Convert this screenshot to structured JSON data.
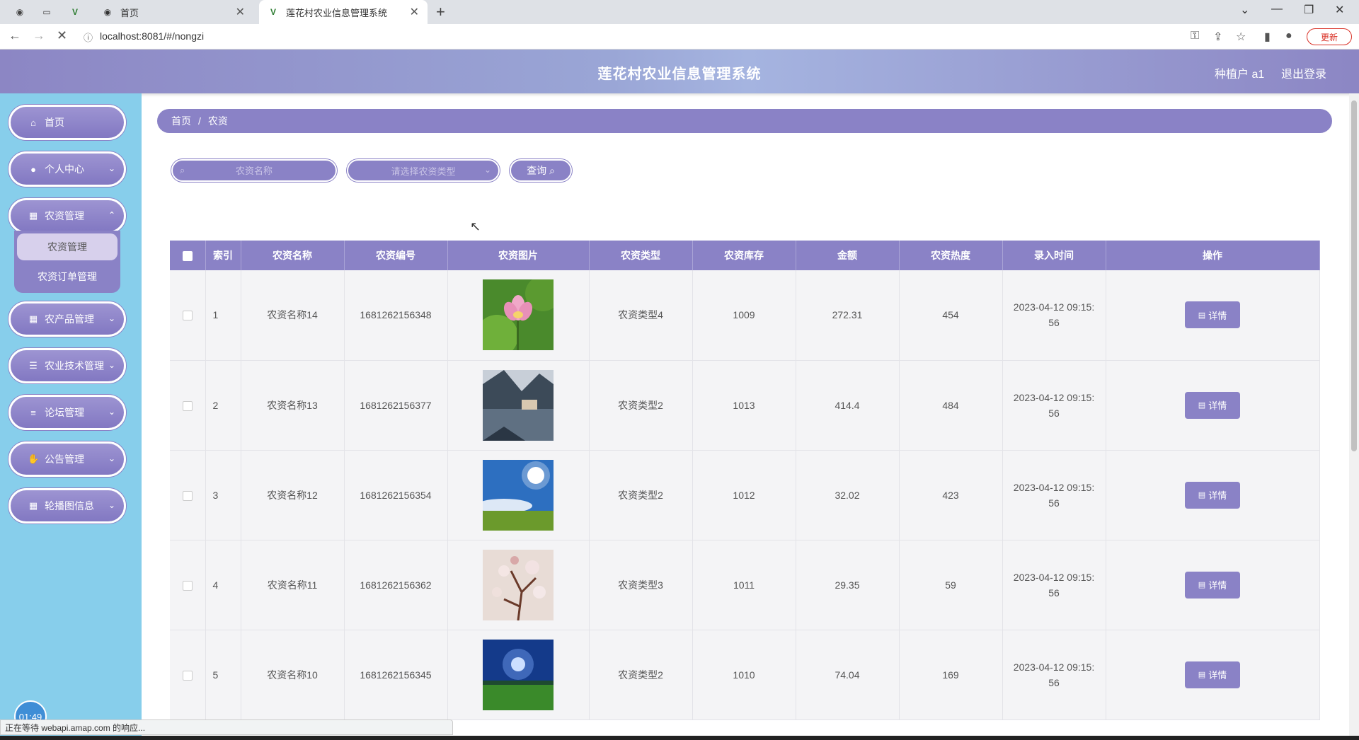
{
  "browser": {
    "tabs": [
      {
        "title": "首页"
      },
      {
        "title": "莲花村农业信息管理系统"
      }
    ],
    "url": "localhost:8081/#/nongzi",
    "update_label": "更新"
  },
  "header": {
    "title": "莲花村农业信息管理系统",
    "user": "种植户 a1",
    "logout": "退出登录"
  },
  "sidebar": {
    "items": [
      {
        "label": "首页",
        "icon": "home-icon"
      },
      {
        "label": "个人中心",
        "icon": "user-icon"
      },
      {
        "label": "农资管理",
        "icon": "grid-icon"
      },
      {
        "label": "农产品管理",
        "icon": "grid-icon"
      },
      {
        "label": "农业技术管理",
        "icon": "sliders-icon"
      },
      {
        "label": "论坛管理",
        "icon": "list-icon"
      },
      {
        "label": "公告管理",
        "icon": "thumb-icon"
      },
      {
        "label": "轮播图信息",
        "icon": "grid-icon"
      }
    ],
    "submenu": [
      {
        "label": "农资管理"
      },
      {
        "label": "农资订单管理"
      }
    ],
    "timer": "01:49"
  },
  "breadcrumb": {
    "home": "首页",
    "current": "农资"
  },
  "filters": {
    "name_placeholder": "农资名称",
    "type_placeholder": "请选择农资类型",
    "query_label": "查询"
  },
  "table": {
    "columns": [
      "索引",
      "农资名称",
      "农资编号",
      "农资图片",
      "农资类型",
      "农资库存",
      "金额",
      "农资热度",
      "录入时间",
      "操作"
    ],
    "rows": [
      {
        "index": "1",
        "name": "农资名称14",
        "code": "1681262156348",
        "type": "农资类型4",
        "stock": "1009",
        "amount": "272.31",
        "heat": "454",
        "time1": "2023-04-12 09:15:",
        "time2": "56",
        "action": "详情",
        "image": "lotus"
      },
      {
        "index": "2",
        "name": "农资名称13",
        "code": "1681262156377",
        "type": "农资类型2",
        "stock": "1013",
        "amount": "414.4",
        "heat": "484",
        "time1": "2023-04-12 09:15:",
        "time2": "56",
        "action": "详情",
        "image": "lake-village"
      },
      {
        "index": "3",
        "name": "农资名称12",
        "code": "1681262156354",
        "type": "农资类型2",
        "stock": "1012",
        "amount": "32.02",
        "heat": "423",
        "time1": "2023-04-12 09:15:",
        "time2": "56",
        "action": "详情",
        "image": "sunny-field"
      },
      {
        "index": "4",
        "name": "农资名称11",
        "code": "1681262156362",
        "type": "农资类型3",
        "stock": "1011",
        "amount": "29.35",
        "heat": "59",
        "time1": "2023-04-12 09:15:",
        "time2": "56",
        "action": "详情",
        "image": "blossom"
      },
      {
        "index": "5",
        "name": "农资名称10",
        "code": "1681262156345",
        "type": "农资类型2",
        "stock": "1010",
        "amount": "74.04",
        "heat": "169",
        "time1": "2023-04-12 09:15:",
        "time2": "56",
        "action": "详情",
        "image": "blue-meadow"
      }
    ]
  },
  "status": "正在等待 webapi.amap.com 的响应..."
}
